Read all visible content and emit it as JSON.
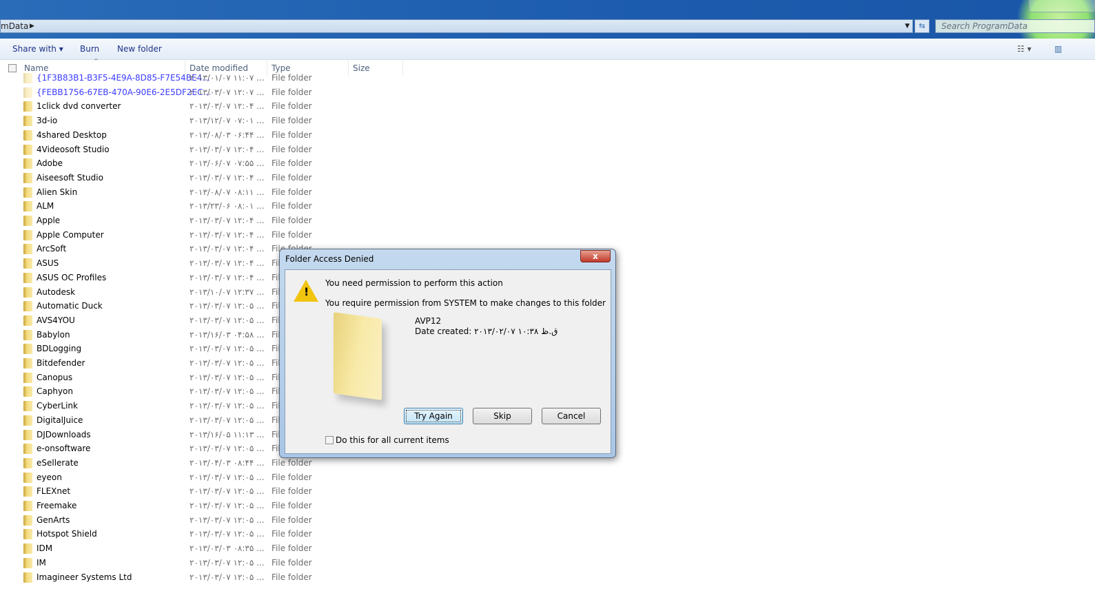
{
  "address": {
    "path": "mData",
    "search_placeholder": "Search ProgramData"
  },
  "toolbar": {
    "share_with": "Share with",
    "burn": "Burn",
    "new_folder": "New folder"
  },
  "columns": {
    "name": "Name",
    "date": "Date modified",
    "type": "Type",
    "size": "Size"
  },
  "rows": [
    {
      "name": "{1F3B83B1-B3F5-4E9A-8D85-F7E54BE4...",
      "date": "۲۰۱۳/۰۱/۰۷ ۱۱:۰۷ ...",
      "type": "File folder",
      "hidden": true
    },
    {
      "name": "{FEBB1756-67EB-470A-90E6-2E5DF2EC...",
      "date": "۲۰۱۳/۰۳/۰۷ ۱۲:۰۷ ...",
      "type": "File folder",
      "hidden": true
    },
    {
      "name": "1click dvd converter",
      "date": "۲۰۱۳/۰۳/۰۷ ۱۲:۰۴ ...",
      "type": "File folder"
    },
    {
      "name": "3d-io",
      "date": "۲۰۱۳/۱۲/۰۷ ۰۷:۰۱ ...",
      "type": "File folder"
    },
    {
      "name": "4shared Desktop",
      "date": "۲۰۱۳/۰۸/۰۳ ۰۶:۴۴ ...",
      "type": "File folder"
    },
    {
      "name": "4Videosoft Studio",
      "date": "۲۰۱۳/۰۳/۰۷ ۱۲:۰۴ ...",
      "type": "File folder"
    },
    {
      "name": "Adobe",
      "date": "۲۰۱۳/۰۶/۰۷ ۰۷:۵۵ ...",
      "type": "File folder"
    },
    {
      "name": "Aiseesoft Studio",
      "date": "۲۰۱۳/۰۳/۰۷ ۱۲:۰۴ ...",
      "type": "File folder"
    },
    {
      "name": "Alien Skin",
      "date": "۲۰۱۳/۰۸/۰۷ ۰۸:۱۱ ...",
      "type": "File folder"
    },
    {
      "name": "ALM",
      "date": "۲۰۱۳/۲۳/۰۶ ۰۸:۰۱ ...",
      "type": "File folder"
    },
    {
      "name": "Apple",
      "date": "۲۰۱۳/۰۳/۰۷ ۱۲:۰۴ ...",
      "type": "File folder"
    },
    {
      "name": "Apple Computer",
      "date": "۲۰۱۳/۰۳/۰۷ ۱۲:۰۴ ...",
      "type": "File folder"
    },
    {
      "name": "ArcSoft",
      "date": "۲۰۱۳/۰۳/۰۷ ۱۲:۰۴ ...",
      "type": "File folder"
    },
    {
      "name": "ASUS",
      "date": "۲۰۱۳/۰۳/۰۷ ۱۲:۰۴ ...",
      "type": "File folder"
    },
    {
      "name": "ASUS OC Profiles",
      "date": "۲۰۱۳/۰۳/۰۷ ۱۲:۰۴ ...",
      "type": "File folder"
    },
    {
      "name": "Autodesk",
      "date": "۲۰۱۳/۱۰/۰۷ ۱۲:۳۷ ...",
      "type": "File folder"
    },
    {
      "name": "Automatic Duck",
      "date": "۲۰۱۳/۰۳/۰۷ ۱۲:۰۵ ...",
      "type": "File folder"
    },
    {
      "name": "AVS4YOU",
      "date": "۲۰۱۳/۰۳/۰۷ ۱۲:۰۵ ...",
      "type": "File folder"
    },
    {
      "name": "Babylon",
      "date": "۲۰۱۳/۱۶/۰۳ ۰۴:۵۸ ...",
      "type": "File folder"
    },
    {
      "name": "BDLogging",
      "date": "۲۰۱۳/۰۳/۰۷ ۱۲:۰۵ ...",
      "type": "File folder"
    },
    {
      "name": "Bitdefender",
      "date": "۲۰۱۳/۰۳/۰۷ ۱۲:۰۵ ...",
      "type": "File folder"
    },
    {
      "name": "Canopus",
      "date": "۲۰۱۳/۰۳/۰۷ ۱۲:۰۵ ...",
      "type": "File folder"
    },
    {
      "name": "Caphyon",
      "date": "۲۰۱۳/۰۳/۰۷ ۱۲:۰۵ ...",
      "type": "File folder"
    },
    {
      "name": "CyberLink",
      "date": "۲۰۱۳/۰۳/۰۷ ۱۲:۰۵ ...",
      "type": "File folder"
    },
    {
      "name": "DigitalJuice",
      "date": "۲۰۱۳/۰۳/۰۷ ۱۲:۰۵ ...",
      "type": "File folder"
    },
    {
      "name": "DJDownloads",
      "date": "۲۰۱۳/۱۶/۰۵ ۱۱:۱۳ ...",
      "type": "File folder"
    },
    {
      "name": "e-onsoftware",
      "date": "۲۰۱۳/۰۳/۰۷ ۱۲:۰۵ ...",
      "type": "File folder"
    },
    {
      "name": "eSellerate",
      "date": "۲۰۱۳/۰۴/۰۳ ۰۸:۴۴ ...",
      "type": "File folder"
    },
    {
      "name": "eyeon",
      "date": "۲۰۱۳/۰۳/۰۷ ۱۲:۰۵ ...",
      "type": "File folder"
    },
    {
      "name": "FLEXnet",
      "date": "۲۰۱۳/۰۳/۰۷ ۱۲:۰۵ ...",
      "type": "File folder"
    },
    {
      "name": "Freemake",
      "date": "۲۰۱۳/۰۳/۰۷ ۱۲:۰۵ ...",
      "type": "File folder"
    },
    {
      "name": "GenArts",
      "date": "۲۰۱۳/۰۳/۰۷ ۱۲:۰۵ ...",
      "type": "File folder"
    },
    {
      "name": "Hotspot Shield",
      "date": "۲۰۱۳/۰۳/۰۷ ۱۲:۰۵ ...",
      "type": "File folder"
    },
    {
      "name": "IDM",
      "date": "۲۰۱۳/۰۳/۰۳ ۰۸:۳۵ ...",
      "type": "File folder"
    },
    {
      "name": "IM",
      "date": "۲۰۱۳/۰۳/۰۷ ۱۲:۰۵ ...",
      "type": "File folder"
    },
    {
      "name": "Imagineer Systems Ltd",
      "date": "۲۰۱۳/۰۳/۰۷ ۱۲:۰۵ ...",
      "type": "File folder"
    }
  ],
  "dialog": {
    "title": "Folder Access Denied",
    "close": "x",
    "heading": "You need permission to perform this action",
    "message": "You require permission from SYSTEM to make changes to this folder",
    "folder_name": "AVP12",
    "date_created": "Date created: ۲۰۱۳/۰۲/۰۷ ق.ظ ۱۰:۳۸",
    "try_again": "Try Again",
    "skip": "Skip",
    "cancel": "Cancel",
    "checkbox_label": "Do this for all current items",
    "checkbox_checked": false
  }
}
